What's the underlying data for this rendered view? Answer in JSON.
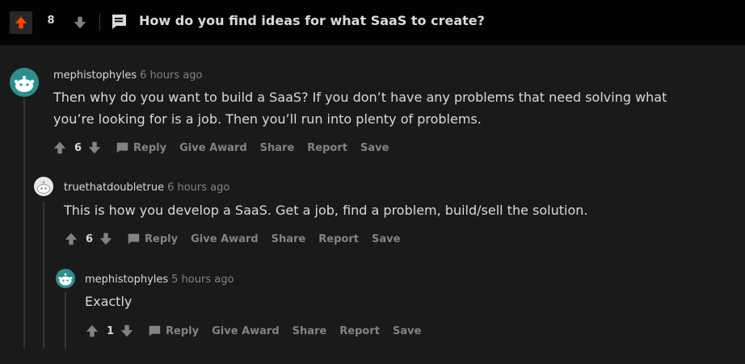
{
  "post": {
    "score": "8",
    "title": "How do you find ideas for what SaaS to create?"
  },
  "comments": [
    {
      "username": "mephistophyles",
      "age": "6 hours ago",
      "body_line1": "Then why do you want to build a SaaS? If you don’t have any problems that need solving what",
      "body_line2": "you’re looking for is a job. Then you’ll run into plenty of problems.",
      "score": "6"
    },
    {
      "username": "truethatdoubletrue",
      "age": "6 hours ago",
      "body_line1": "This is how you develop a SaaS. Get a job, find a problem, build/sell the solution.",
      "score": "6"
    },
    {
      "username": "mephistophyles",
      "age": "5 hours ago",
      "body_line1": "Exactly",
      "score": "1"
    }
  ],
  "actions": {
    "reply": "Reply",
    "give_award": "Give Award",
    "share": "Share",
    "report": "Report",
    "save": "Save"
  },
  "colors": {
    "upvote_active": "#ff4500",
    "background": "#1a1a1b",
    "topbar": "#030303",
    "muted_text": "#818384",
    "avatar_teal": "#2c8f8f"
  }
}
